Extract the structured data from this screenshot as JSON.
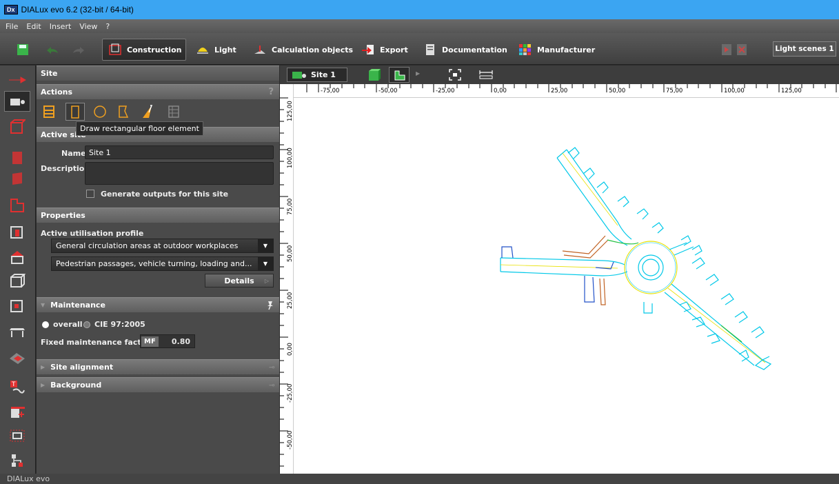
{
  "window": {
    "app_badge": "Dx",
    "title": "DIALux evo 6.2  (32-bit / 64-bit)"
  },
  "menu": [
    "File",
    "Edit",
    "Insert",
    "View",
    "?"
  ],
  "toolbar": {
    "construction": "Construction",
    "light": "Light",
    "calculation_objects": "Calculation objects",
    "export": "Export",
    "documentation": "Documentation",
    "manufacturer": "Manufacturer",
    "light_scenes": "Light scenes 1"
  },
  "panel": {
    "site_header": "Site",
    "actions_header": "Actions",
    "help": "?",
    "tooltip": "Draw rectangular floor element",
    "active_site_header": "Active site",
    "name_label": "Name",
    "name_value": "Site 1",
    "description_label": "Description",
    "description_value": "",
    "generate_outputs": "Generate outputs for this site",
    "properties_header": "Properties",
    "utilisation_label": "Active utilisation profile",
    "profile_1": "General circulation areas at outdoor workplaces",
    "profile_2": "Pedestrian passages, vehicle turning, loading and...",
    "details_button": "Details",
    "maintenance_header": "Maintenance",
    "overall": "overall",
    "cie": "CIE 97:2005",
    "fixed_factor_label": "Fixed maintenance factor",
    "mf_badge": "MF",
    "mf_value": "0.80",
    "site_alignment": "Site alignment",
    "background": "Background"
  },
  "view": {
    "site_tab": "Site 1",
    "ruler_x": [
      "-75,00",
      "-50,00",
      "-25,00",
      "0,00",
      "25,00",
      "50,00",
      "75,00",
      "100,00",
      "125,00"
    ],
    "ruler_y": [
      "125,00",
      "100,00",
      "75,00",
      "50,00",
      "25,00",
      "0,00",
      "-25,00",
      "-50,00"
    ]
  },
  "status": "DIALux evo",
  "colors": {
    "title_bar": "#3ba5f2",
    "accent_orange": "#f0a020",
    "drawing_cyan": "#00c8e8",
    "drawing_yellow": "#e8e000"
  }
}
